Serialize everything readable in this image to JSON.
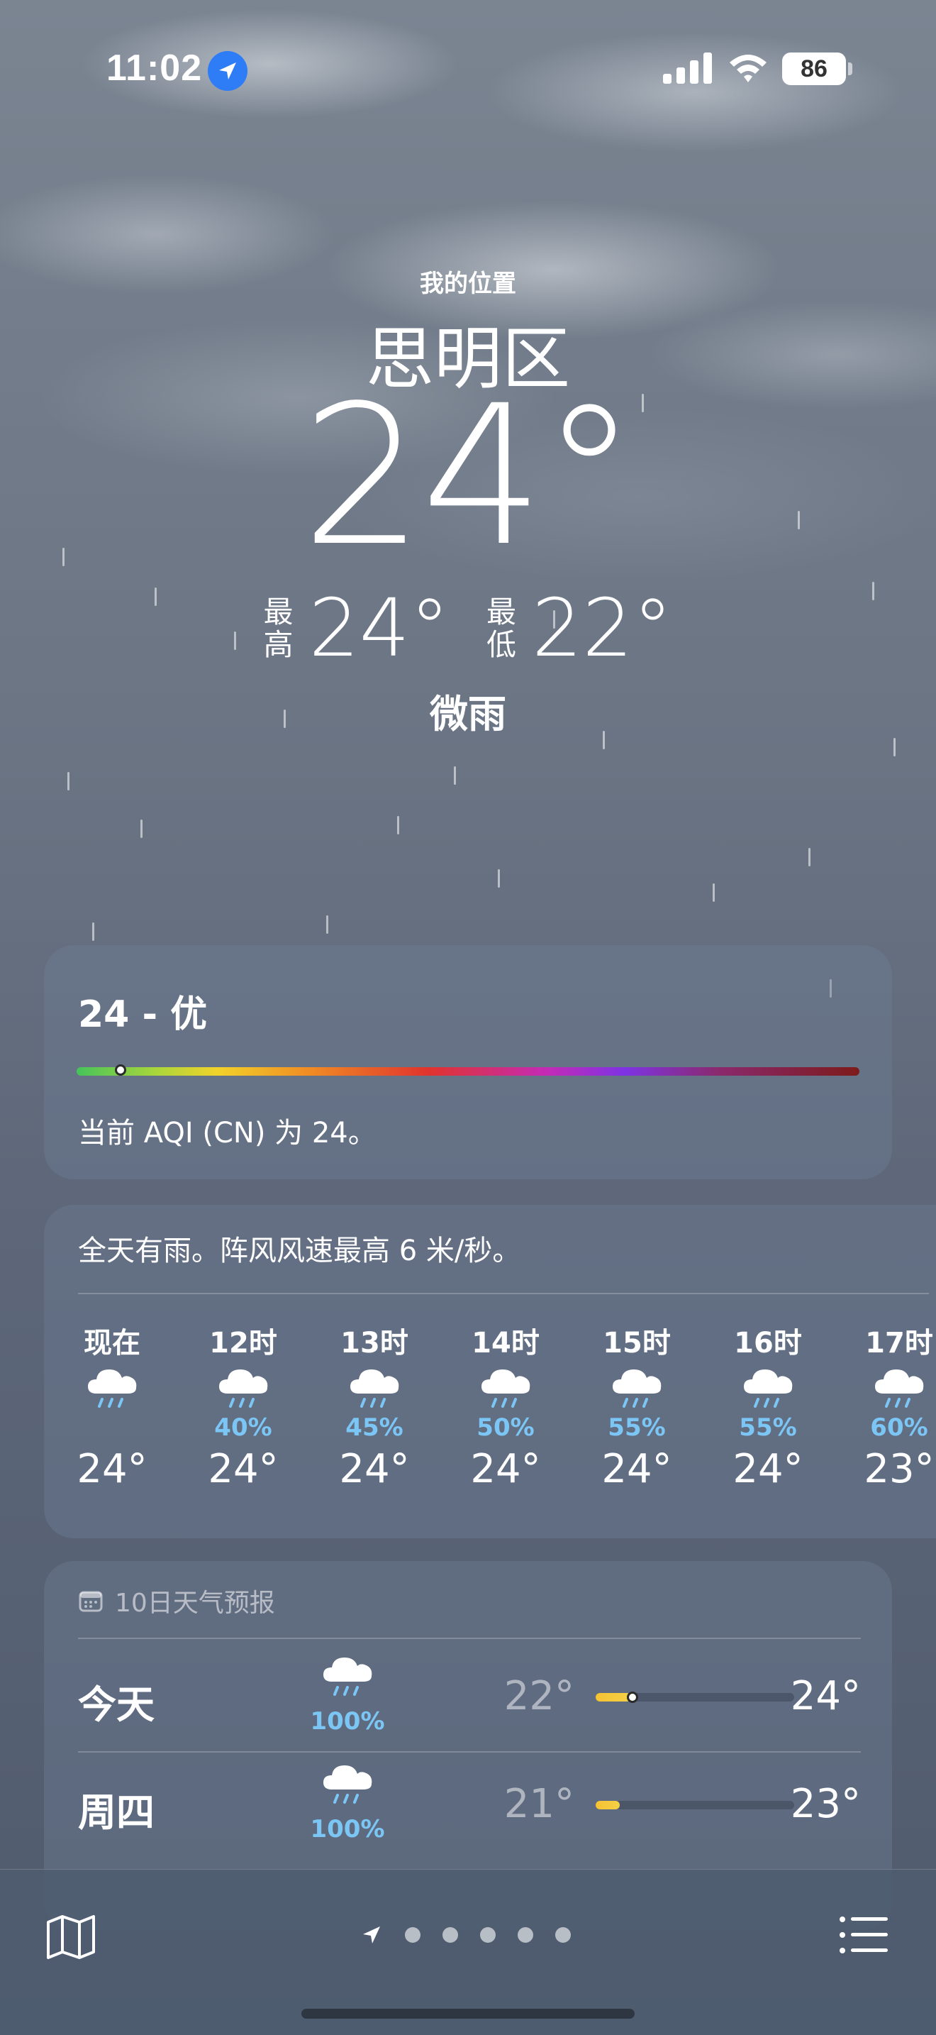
{
  "status_bar": {
    "time": "11:02",
    "battery": "86"
  },
  "header": {
    "location_label": "我的位置",
    "city": "思明区",
    "temperature": "24°",
    "high_label_top": "最",
    "high_label_bottom": "高",
    "high": "24°",
    "low_label_top": "最",
    "low_label_bottom": "低",
    "low": "22°",
    "condition": "微雨"
  },
  "aqi": {
    "title": "24 - 优",
    "description": "当前 AQI (CN) 为 24。",
    "level_fraction": 0.04
  },
  "hourly": {
    "summary": "全天有雨。阵风风速最高 6 米/秒。",
    "items": [
      {
        "label": "现在",
        "pop": "",
        "temp": "24°",
        "icon": "rain-cloud-icon"
      },
      {
        "label": "12时",
        "pop": "40%",
        "temp": "24°",
        "icon": "rain-cloud-icon"
      },
      {
        "label": "13时",
        "pop": "45%",
        "temp": "24°",
        "icon": "rain-cloud-icon"
      },
      {
        "label": "14时",
        "pop": "50%",
        "temp": "24°",
        "icon": "rain-cloud-icon"
      },
      {
        "label": "15时",
        "pop": "55%",
        "temp": "24°",
        "icon": "rain-cloud-icon"
      },
      {
        "label": "16时",
        "pop": "55%",
        "temp": "24°",
        "icon": "rain-cloud-icon"
      },
      {
        "label": "17时",
        "pop": "60%",
        "temp": "23°",
        "icon": "rain-cloud-icon"
      }
    ]
  },
  "daily": {
    "header": "10日天气预报",
    "days": [
      {
        "name": "今天",
        "pop": "100%",
        "low": "22°",
        "high": "24°",
        "icon": "rain-cloud-icon",
        "range_start": 0.0,
        "range_end": 0.18,
        "now_marker": 0.18
      },
      {
        "name": "周四",
        "pop": "100%",
        "low": "21°",
        "high": "23°",
        "icon": "rain-cloud-icon",
        "range_start": 0.0,
        "range_end": 0.12
      }
    ]
  },
  "bottom_bar": {
    "map_icon": "map-icon",
    "list_icon": "list-icon",
    "pager_current_icon": "location-arrow-icon",
    "pages": 5
  },
  "colors": {
    "pop_blue": "#7cc6f6",
    "range_yellow": "#f6c233",
    "location_blue": "#2f7df6"
  }
}
